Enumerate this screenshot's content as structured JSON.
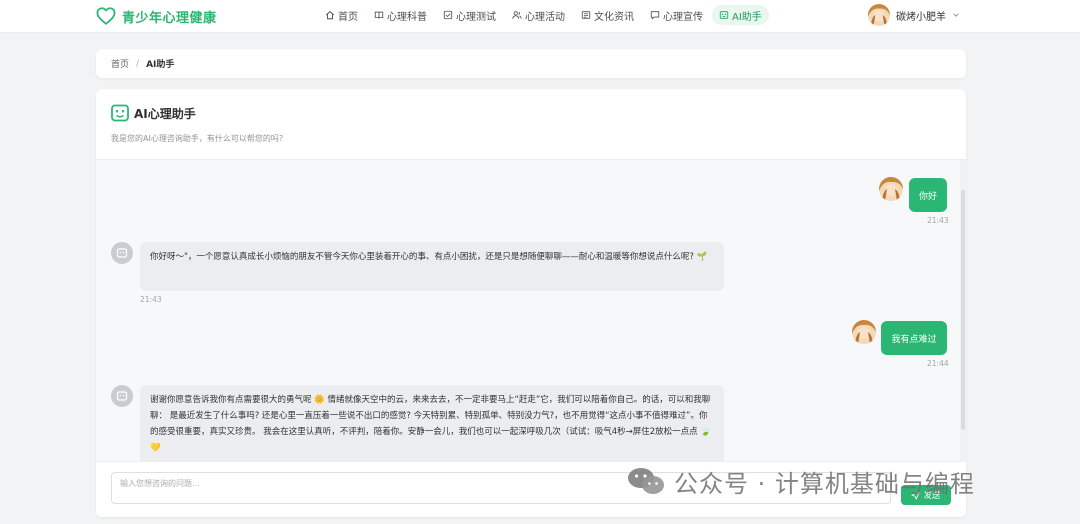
{
  "brand": {
    "name": "青少年心理健康",
    "color": "#2bb673"
  },
  "nav": {
    "items": [
      {
        "label": "首页",
        "icon": "home-icon"
      },
      {
        "label": "心理科普",
        "icon": "book-icon"
      },
      {
        "label": "心理测试",
        "icon": "checkbox-icon"
      },
      {
        "label": "心理活动",
        "icon": "users-icon"
      },
      {
        "label": "文化资讯",
        "icon": "news-icon"
      },
      {
        "label": "心理宣传",
        "icon": "message-icon"
      },
      {
        "label": "AI助手",
        "icon": "robot-icon",
        "active": true
      }
    ]
  },
  "user": {
    "name": "碳烤小肥羊"
  },
  "breadcrumb": {
    "home": "首页",
    "separator": "/",
    "current": "AI助手"
  },
  "chat": {
    "title": "AI心理助手",
    "subtitle": "我是您的AI心理咨询助手，有什么可以帮您的吗?",
    "messages": [
      {
        "role": "user",
        "text": "你好",
        "time": "21:43"
      },
      {
        "role": "assistant",
        "text": "你好呀～\"，一个愿意认真成长小烦恼的朋友不管今天你心里装着开心的事、有点小困扰，还是只是想随便聊聊——耐心和温暖等你想说点什么呢? 🌱",
        "time": "21:43"
      },
      {
        "role": "user",
        "text": "我有点难过",
        "time": "21:44"
      },
      {
        "role": "assistant",
        "text": "谢谢你愿意告诉我你有点需要很大的勇气呢 🌼 情绪就像天空中的云，来来去去，不一定非要马上“赶走”它，我们可以陪着你自己。的话，可以和我聊聊： 是最近发生了什么事吗? 还是心里一直压着一些说不出口的感觉? 今天特别累、特别孤单、特别没力气?，也不用觉得“这点小事不值得难过”。你的感受很重要，真实又珍贵。 我会在这里认真听，不评判，陪着你。安静一会儿，我们也可以一起深呼吸几次（试试：吸气4秒→屏住2放松一点点 🍃 💛"
      }
    ]
  },
  "input": {
    "placeholder": "输入您想咨询的问题...",
    "send_label": "发送"
  },
  "watermark": {
    "text": "公众号 · 计算机基础与编程"
  }
}
